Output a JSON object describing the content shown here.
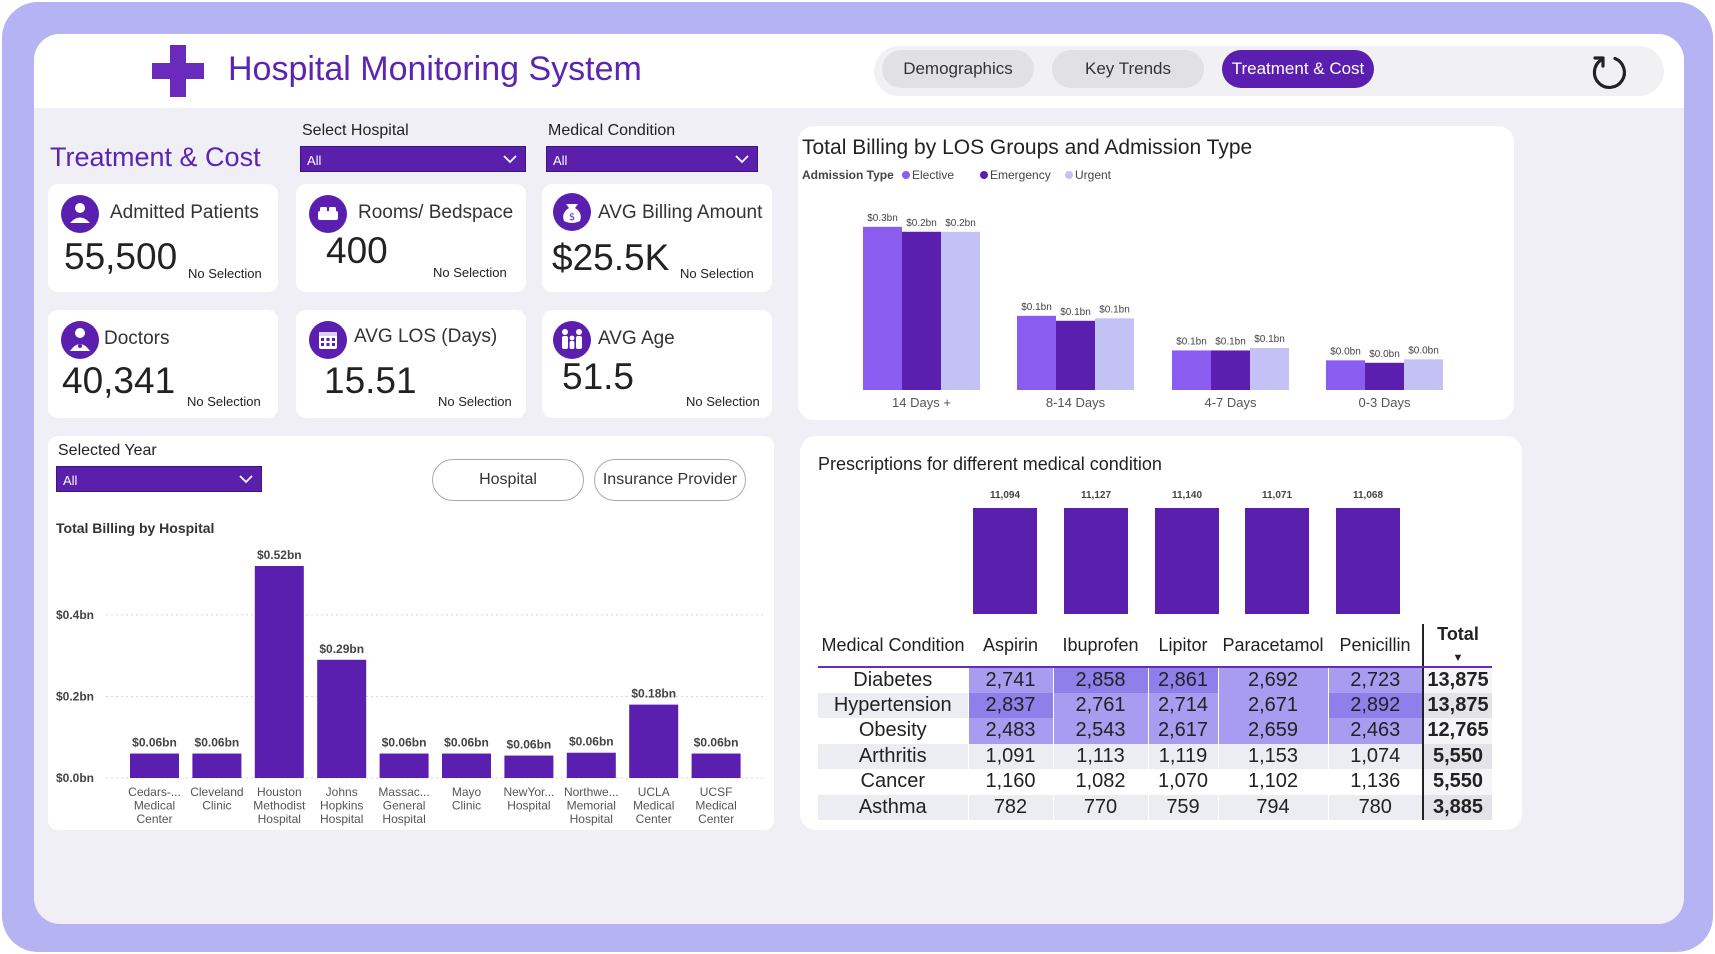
{
  "app": {
    "title": "Hospital Monitoring System"
  },
  "nav": {
    "tabs": [
      {
        "label": "Demographics",
        "active": false
      },
      {
        "label": "Key Trends",
        "active": false
      },
      {
        "label": "Treatment & Cost",
        "active": true
      }
    ],
    "refresh_icon": "refresh-icon"
  },
  "page": {
    "section_title": "Treatment & Cost"
  },
  "filters": {
    "hospital": {
      "label": "Select Hospital",
      "value": "All"
    },
    "condition": {
      "label": "Medical Condition",
      "value": "All"
    },
    "year": {
      "label": "Selected Year",
      "value": "All"
    }
  },
  "kpis": [
    {
      "label": "Admitted Patients",
      "value": "55,500",
      "sub": "No Selection",
      "icon": "patient-icon"
    },
    {
      "label": "Rooms/ Bedspace",
      "value": "400",
      "sub": "No Selection",
      "icon": "bed-icon"
    },
    {
      "label": "AVG Billing Amount",
      "value": "$25.5K",
      "sub": "No Selection",
      "icon": "money-bag-icon"
    },
    {
      "label": "Doctors",
      "value": "40,341",
      "sub": "No Selection",
      "icon": "doctor-icon"
    },
    {
      "label": "AVG LOS (Days)",
      "value": "15.51",
      "sub": "No Selection",
      "icon": "calendar-icon"
    },
    {
      "label": "AVG Age",
      "value": "51.5",
      "sub": "No Selection",
      "icon": "family-icon"
    }
  ],
  "toggles": {
    "hospital": "Hospital",
    "insurance": "Insurance Provider"
  },
  "colors": {
    "brand": "#5b1fb0",
    "elective": "#8b5cf0",
    "emergency": "#5b1fb0",
    "urgent": "#c4c2f4",
    "frame": "#b5b3f2"
  },
  "chart_data": [
    {
      "type": "bar",
      "title": "Total Billing by LOS Groups and Admission Type",
      "legend_title": "Admission Type",
      "categories": [
        "14 Days +",
        "8-14 Days",
        "4-7 Days",
        "0-3 Days"
      ],
      "series": [
        {
          "name": "Elective",
          "values": [
            0.33,
            0.15,
            0.08,
            0.06
          ],
          "labels": [
            "$0.3bn",
            "$0.1bn",
            "$0.1bn",
            "$0.0bn"
          ]
        },
        {
          "name": "Emergency",
          "values": [
            0.32,
            0.14,
            0.08,
            0.055
          ],
          "labels": [
            "$0.2bn",
            "$0.1bn",
            "$0.1bn",
            "$0.0bn"
          ]
        },
        {
          "name": "Urgent",
          "values": [
            0.32,
            0.145,
            0.085,
            0.062
          ],
          "labels": [
            "$0.2bn",
            "$0.1bn",
            "$0.1bn",
            "$0.0bn"
          ]
        }
      ],
      "ylim": [
        0,
        0.36
      ],
      "legend_position": "top-left",
      "grid": false
    },
    {
      "type": "bar",
      "title": "Total Billing by Hospital",
      "categories": [
        "Cedars-... Medical Center",
        "Cleveland Clinic",
        "Houston Methodist Hospital",
        "Johns Hopkins Hospital",
        "Massac... General Hospital",
        "Mayo Clinic",
        "NewYor... Hospital",
        "Northwe... Memorial Hospital",
        "UCLA Medical Center",
        "UCSF Medical Center"
      ],
      "values": [
        0.06,
        0.06,
        0.52,
        0.29,
        0.06,
        0.06,
        0.055,
        0.062,
        0.18,
        0.06
      ],
      "labels": [
        "$0.06bn",
        "$0.06bn",
        "$0.52bn",
        "$0.29bn",
        "$0.06bn",
        "$0.06bn",
        "$0.06bn",
        "$0.06bn",
        "$0.18bn",
        "$0.06bn"
      ],
      "yticks": [
        "$0.0bn",
        "$0.2bn",
        "$0.4bn"
      ],
      "ytick_values": [
        0,
        0.2,
        0.4
      ],
      "ylim": [
        0,
        0.52
      ],
      "grid": true
    },
    {
      "type": "bar",
      "title": "Prescriptions for different medical condition",
      "categories": [
        "Aspirin",
        "Ibuprofen",
        "Lipitor",
        "Paracetamol",
        "Penicillin"
      ],
      "values": [
        11094,
        11127,
        11140,
        11071,
        11068
      ],
      "labels": [
        "11,094",
        "11,127",
        "11,140",
        "11,071",
        "11,068"
      ],
      "grid": false
    }
  ],
  "table": {
    "columns": [
      "Medical Condition",
      "Aspirin",
      "Ibuprofen",
      "Lipitor",
      "Paracetamol",
      "Penicillin",
      "Total"
    ],
    "rows": [
      [
        "Diabetes",
        "2,741",
        "2,858",
        "2,861",
        "2,692",
        "2,723",
        "13,875"
      ],
      [
        "Hypertension",
        "2,837",
        "2,761",
        "2,714",
        "2,671",
        "2,892",
        "13,875"
      ],
      [
        "Obesity",
        "2,483",
        "2,543",
        "2,617",
        "2,659",
        "2,463",
        "12,765"
      ],
      [
        "Arthritis",
        "1,091",
        "1,113",
        "1,119",
        "1,153",
        "1,074",
        "5,550"
      ],
      [
        "Cancer",
        "1,160",
        "1,082",
        "1,070",
        "1,102",
        "1,136",
        "5,550"
      ],
      [
        "Asthma",
        "782",
        "770",
        "759",
        "794",
        "780",
        "3,885"
      ]
    ],
    "heat": [
      [
        "#a79cf0",
        "#8e7fea",
        "#8e7fea",
        "#a79cf0",
        "#a79cf0"
      ],
      [
        "#8e7fea",
        "#a79cf0",
        "#a79cf0",
        "#a79cf0",
        "#8e7fea"
      ],
      [
        "#a79cf0",
        "#a79cf0",
        "#a79cf0",
        "#a79cf0",
        "#a79cf0"
      ],
      [
        "",
        "",
        "",
        "",
        ""
      ],
      [
        "",
        "",
        "",
        "",
        ""
      ],
      [
        "",
        "",
        "",
        "",
        ""
      ]
    ]
  }
}
